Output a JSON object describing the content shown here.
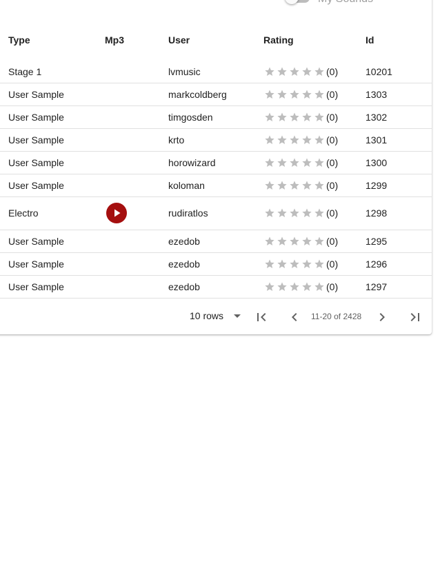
{
  "header": {
    "toggle_label": "My Sounds"
  },
  "columns": {
    "type": "Type",
    "mp3": "Mp3",
    "user": "User",
    "rating": "Rating",
    "id": "Id"
  },
  "rows": [
    {
      "type": "Stage 1",
      "user": "lvmusic",
      "rating_count": "(0)",
      "id": "10201",
      "has_mp3": false
    },
    {
      "type": "User Sample",
      "user": "markcoldberg",
      "rating_count": "(0)",
      "id": "1303",
      "has_mp3": false
    },
    {
      "type": "User Sample",
      "user": "timgosden",
      "rating_count": "(0)",
      "id": "1302",
      "has_mp3": false
    },
    {
      "type": "User Sample",
      "user": "krto",
      "rating_count": "(0)",
      "id": "1301",
      "has_mp3": false
    },
    {
      "type": "User Sample",
      "user": "horowizard",
      "rating_count": "(0)",
      "id": "1300",
      "has_mp3": false
    },
    {
      "type": "User Sample",
      "user": "koloman",
      "rating_count": "(0)",
      "id": "1299",
      "has_mp3": false
    },
    {
      "type": "Electro",
      "user": "rudiratlos",
      "rating_count": "(0)",
      "id": "1298",
      "has_mp3": true
    },
    {
      "type": "User Sample",
      "user": "ezedob",
      "rating_count": "(0)",
      "id": "1295",
      "has_mp3": false
    },
    {
      "type": "User Sample",
      "user": "ezedob",
      "rating_count": "(0)",
      "id": "1296",
      "has_mp3": false
    },
    {
      "type": "User Sample",
      "user": "ezedob",
      "rating_count": "(0)",
      "id": "1297",
      "has_mp3": false
    }
  ],
  "pagination": {
    "rows_per_page": "10 rows",
    "range": "11-20 of 2428"
  },
  "colors": {
    "accent": "#a50f0f",
    "star": "#bdbdbd",
    "divider": "#e0e0e0"
  },
  "icons": {
    "play": "play-icon",
    "star": "star-icon",
    "first": "first-page-icon",
    "prev": "chevron-left-icon",
    "next": "chevron-right-icon",
    "last": "last-page-icon"
  }
}
